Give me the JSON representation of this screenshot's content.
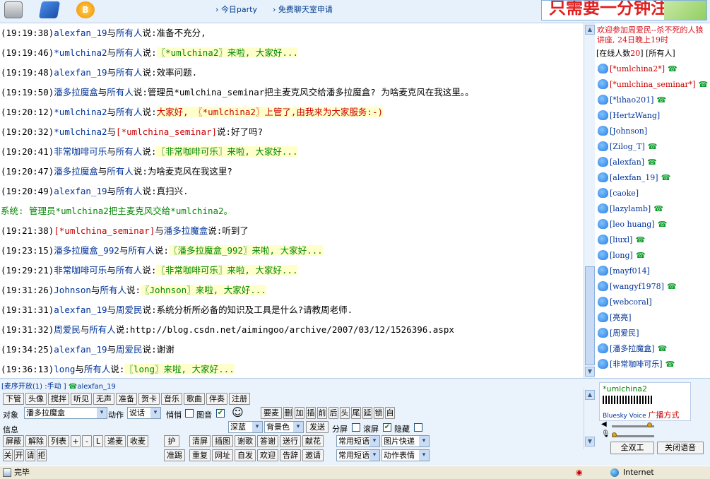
{
  "top": {
    "nav": [
      "今日party",
      "免费聊天室申请"
    ],
    "banner_text": "只需要一分钟注册"
  },
  "messages": [
    {
      "time": "(19:19:38)",
      "from": "alexfan_19",
      "mid": "与",
      "to": "所有人",
      "verb": "说:",
      "text": "准备不充分,",
      "style": "plain"
    },
    {
      "time": "(19:19:46)",
      "from": "*umlchina2",
      "mid": "与",
      "to": "所有人",
      "verb": "说:",
      "text": "〖*umlchina2〗来啦, 大家好...",
      "style": "greet"
    },
    {
      "time": "(19:19:48)",
      "from": "alexfan_19",
      "mid": "与",
      "to": "所有人",
      "verb": "说:",
      "text": "效率问题.",
      "style": "plain"
    },
    {
      "time": "(19:19:50)",
      "from": "潘多拉魔盒",
      "mid": "与",
      "to": "所有人",
      "verb": "说:",
      "text": "管理员*umlchina_seminar把主麦克风交给潘多拉魔盒? 为啥麦克风在我这里。。",
      "style": "plain"
    },
    {
      "time": "(19:20:12)",
      "from": "*umlchina2",
      "mid": "与",
      "to": "所有人",
      "verb": "说:",
      "text": "大家好, 〖*umlchina2〗上管了,由我来为大家服务:-)",
      "style": "redhl"
    },
    {
      "time": "(19:20:32)",
      "from": "*umlchina2",
      "mid": "与",
      "to": "[*umlchina_seminar]",
      "verb": "说:",
      "text": "好了吗?",
      "style": "redto"
    },
    {
      "time": "(19:20:41)",
      "from": "非常咖啡可乐",
      "mid": "与",
      "to": "所有人",
      "verb": "说:",
      "text": "〖非常咖啡可乐〗来啦, 大家好...",
      "style": "greet"
    },
    {
      "time": "(19:20:47)",
      "from": "潘多拉魔盒",
      "mid": "与",
      "to": "所有人",
      "verb": "说:",
      "text": "为啥麦克风在我这里?",
      "style": "plain"
    },
    {
      "time": "(19:20:49)",
      "from": "alexfan_19",
      "mid": "与",
      "to": "所有人",
      "verb": "说:",
      "text": "真扫兴.",
      "style": "plain"
    },
    {
      "time": "",
      "from": "",
      "mid": "",
      "to": "",
      "verb": "",
      "text": "系统:  管理员*umlchina2把主麦克风交给*umlchina2。",
      "style": "sys"
    },
    {
      "time": "(19:21:38)",
      "from": "[*umlchina_seminar]",
      "mid": "与",
      "to": "潘多拉魔盒",
      "verb": "说:",
      "text": "听到了",
      "style": "redfrom"
    },
    {
      "time": "(19:23:15)",
      "from": "潘多拉魔盒_992",
      "mid": "与",
      "to": "所有人",
      "verb": "说:",
      "text": "〖潘多拉魔盒_992〗来啦, 大家好...",
      "style": "greet"
    },
    {
      "time": "(19:29:21)",
      "from": "非常咖啡可乐",
      "mid": "与",
      "to": "所有人",
      "verb": "说:",
      "text": "〖非常咖啡可乐〗来啦, 大家好...",
      "style": "greet"
    },
    {
      "time": "(19:31:26)",
      "from": "Johnson",
      "mid": "与",
      "to": "所有人",
      "verb": "说:",
      "text": "〖Johnson〗来啦, 大家好...",
      "style": "greet"
    },
    {
      "time": "(19:31:31)",
      "from": "alexfan_19",
      "mid": "与",
      "to": "周爱民",
      "verb": "说:",
      "text": "系统分析所必备的知识及工具是什么?请教周老师.",
      "style": "plain"
    },
    {
      "time": "(19:31:32)",
      "from": "周爱民",
      "mid": "与",
      "to": "所有人",
      "verb": "说:",
      "text": "http://blog.csdn.net/aimingoo/archive/2007/03/12/1526396.aspx",
      "style": "plain"
    },
    {
      "time": "(19:34:25)",
      "from": "alexfan_19",
      "mid": "与",
      "to": "周爱民",
      "verb": "说:",
      "text": "谢谢",
      "style": "plain"
    },
    {
      "time": "(19:36:13)",
      "from": "long",
      "mid": "与",
      "to": "所有人",
      "verb": "说:",
      "text": "〖long〗来啦, 大家好...",
      "style": "greet"
    }
  ],
  "sidebar": {
    "welcome": "欢迎参加周爱民--杀不死的人狼讲座, 24日晚上19时",
    "online_label": "[在线人数",
    "online_count": "20",
    "online_tail": "] [所有人]",
    "users": [
      {
        "name": "[*umlchina2*]",
        "red": true,
        "phone": true
      },
      {
        "name": "[*umlchina_seminar*]",
        "red": true,
        "phone": true
      },
      {
        "name": "[*lihao201]",
        "red": false,
        "phone": true
      },
      {
        "name": "[HertzWang]",
        "red": false,
        "phone": false
      },
      {
        "name": "[Johnson]",
        "red": false,
        "phone": false
      },
      {
        "name": "[Zilog_T]",
        "red": false,
        "phone": true
      },
      {
        "name": "[alexfan]",
        "red": false,
        "phone": true
      },
      {
        "name": "[alexfan_19]",
        "red": false,
        "phone": true
      },
      {
        "name": "[caoke]",
        "red": false,
        "phone": false
      },
      {
        "name": "[lazylamb]",
        "red": false,
        "phone": true
      },
      {
        "name": "[leo huang]",
        "red": false,
        "phone": true
      },
      {
        "name": "[liuxl]",
        "red": false,
        "phone": true
      },
      {
        "name": "[long]",
        "red": false,
        "phone": true
      },
      {
        "name": "[mayf014]",
        "red": false,
        "phone": false
      },
      {
        "name": "[wangyf1978]",
        "red": false,
        "phone": true
      },
      {
        "name": "[webcoral]",
        "red": false,
        "phone": false
      },
      {
        "name": "[亮亮]",
        "red": false,
        "phone": false
      },
      {
        "name": "[周爱民]",
        "red": false,
        "phone": false
      },
      {
        "name": "[潘多拉魔盒]",
        "red": false,
        "phone": true
      },
      {
        "name": "[非常咖啡可乐]",
        "red": false,
        "phone": true
      }
    ]
  },
  "bottom": {
    "mic_status": "[麦序开放(1) :手动 ]",
    "mic_user": "alexfan_19",
    "row1": [
      "下管",
      "头像",
      "搅拌",
      "听见",
      "无声",
      "准备",
      "贺卡",
      "音乐",
      "歌曲",
      "伴奏",
      "注册"
    ],
    "target_label": "对象",
    "target_value": "潘多拉魔盒",
    "action_label": "动作",
    "action_value": "说话",
    "whisper_label": "悄悄",
    "image_label": "图音",
    "row2_btns": [
      "要麦",
      "删",
      "加",
      "插",
      "前",
      "后",
      "头",
      "尾",
      "延",
      "锁",
      "自"
    ],
    "info_label": "信息",
    "color_value": "深蓝",
    "bgcolor_value": "背景色",
    "send_label": "发送",
    "split_label": "分屏",
    "scroll_label": "滚屏",
    "hide_label": "隐藏",
    "row4": [
      "屏蔽",
      "解除",
      "列表",
      "+",
      "-",
      "L",
      "递麦",
      "收麦",
      "护",
      "清屏",
      "插图",
      "谢歌",
      "答谢",
      "送行",
      "献花"
    ],
    "quick_phrase": "常用短语",
    "pic_quick": "图片快递",
    "row5": [
      "关",
      "开",
      "请",
      "拒"
    ],
    "row5b": [
      "准踢",
      "重复",
      "网址",
      "自发",
      "欢迎",
      "告辞",
      "邀请"
    ],
    "quick_phrase2": "常用短语",
    "action_expr": "动作表情",
    "voice_user": "*umlchina2",
    "voice_brand": "Bluesky Voice",
    "voice_mode": "广播方式",
    "duplex_btn": "全双工",
    "close_voice_btn": "关闭语音"
  },
  "statusbar": {
    "status": "完毕",
    "zone": "Internet"
  }
}
